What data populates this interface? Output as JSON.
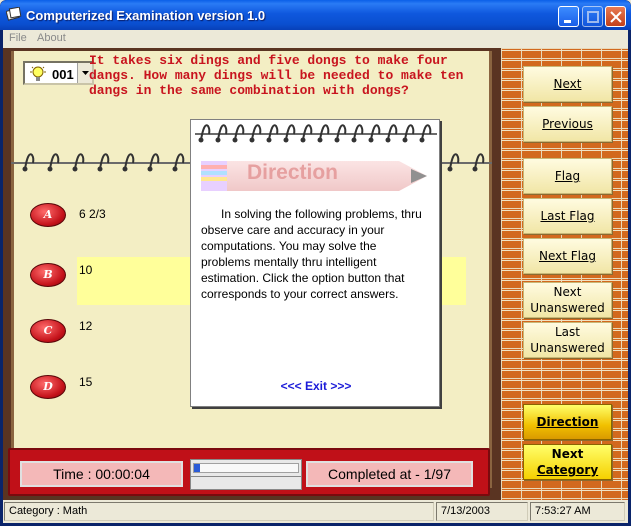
{
  "window": {
    "title": "Computerized Examination version 1.0"
  },
  "menu": {
    "items": [
      "File",
      "About"
    ]
  },
  "question": {
    "number": "001",
    "text": "It takes six dings and five dongs to make four dangs. How many dings will be needed to make ten dangs in the same combination with dongs?"
  },
  "choices": [
    {
      "letter": "A",
      "text": "6 2/3"
    },
    {
      "letter": "B",
      "text": "10"
    },
    {
      "letter": "C",
      "text": "12"
    },
    {
      "letter": "D",
      "text": "15"
    }
  ],
  "selected_choice": "B",
  "status_panel": {
    "time": "Time : 00:00:04",
    "completed": "Completed at - 1/97",
    "progress_fraction": 0.06
  },
  "side_buttons": {
    "next": "Next",
    "previous": "Previous",
    "flag": "Flag",
    "last_flag": "Last Flag",
    "next_flag": "Next Flag",
    "next_unanswered_line1": "Next",
    "next_unanswered_line2": "Unanswered",
    "last_unanswered_line1": "Last",
    "last_unanswered_line2": "Unanswered",
    "direction": "Direction",
    "next_category_line1": "Next",
    "next_category_line2": "Category"
  },
  "dialog": {
    "banner": "Direction",
    "body": "In solving the following problems, thru observe care and accuracy in your computations. You may solve the problems mentally thru intelligent estimation. Click the option button that corresponds to your correct answers.",
    "exit": "<<< Exit >>>"
  },
  "statusbar": {
    "category": "Category : Math",
    "date": "7/13/2003",
    "time": "7:53:27 AM"
  },
  "colors": {
    "question_text": "#c8141e",
    "paper": "#f3eec4",
    "selected_row": "#ffff9a",
    "bottom_bar": "#c01018",
    "exit_link": "#1a1ad8"
  }
}
